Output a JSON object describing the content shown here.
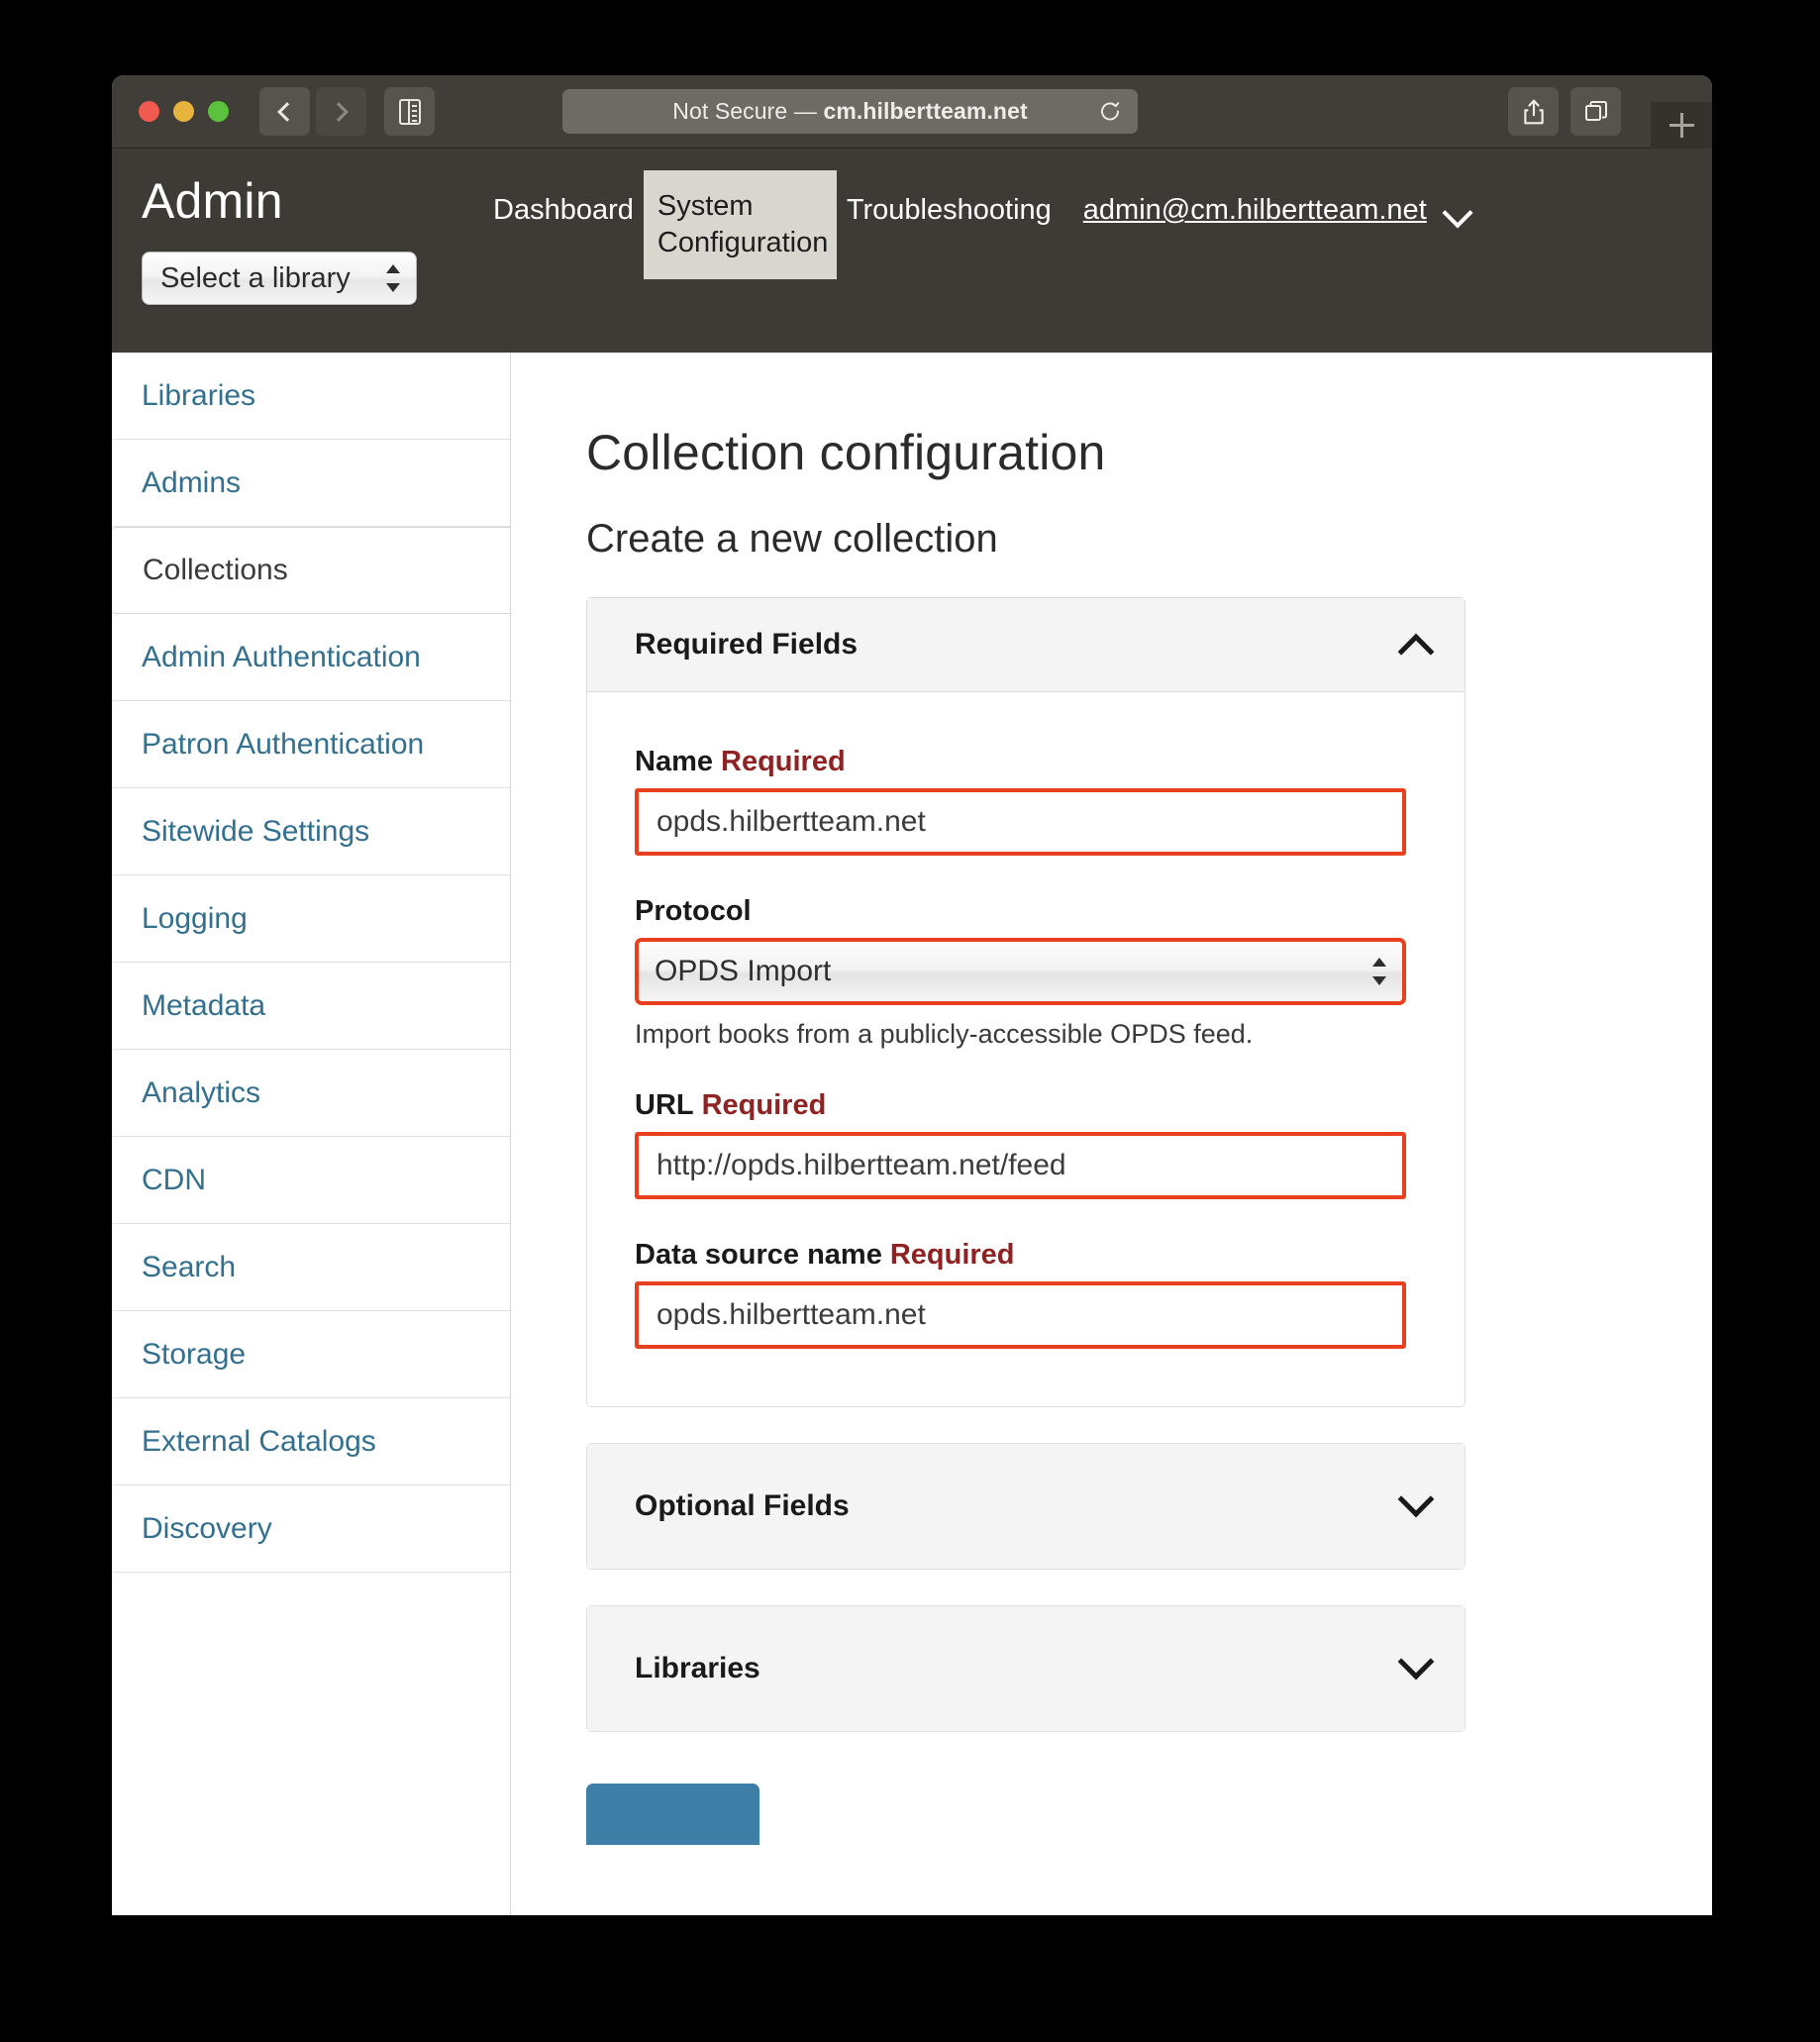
{
  "browser": {
    "url_prefix": "Not Secure",
    "url_separator": "—",
    "url_host": "cm.hilbertteam.net",
    "back_icon": "chevron-left-icon",
    "forward_icon": "chevron-right-icon",
    "sidebar_icon": "sidebar-toggle-icon",
    "reload_icon": "reload-icon",
    "share_icon": "share-icon",
    "tabs_icon": "tab-overview-icon",
    "new_tab_icon": "plus-icon"
  },
  "app_nav": {
    "title": "Admin",
    "library_select_value": "Select a library",
    "links": [
      {
        "label": "Dashboard",
        "active": false
      },
      {
        "label": "System Configuration",
        "active": true
      },
      {
        "label": "Troubleshooting",
        "active": false
      }
    ],
    "user_email": "admin@cm.hilbertteam.net",
    "user_caret_icon": "chevron-down-icon"
  },
  "sidebar": {
    "items": [
      {
        "label": "Libraries",
        "active": false
      },
      {
        "label": "Admins",
        "active": false
      },
      {
        "label": "Collections",
        "active": true
      },
      {
        "label": "Admin Authentication",
        "active": false
      },
      {
        "label": "Patron Authentication",
        "active": false
      },
      {
        "label": "Sitewide Settings",
        "active": false
      },
      {
        "label": "Logging",
        "active": false
      },
      {
        "label": "Metadata",
        "active": false
      },
      {
        "label": "Analytics",
        "active": false
      },
      {
        "label": "CDN",
        "active": false
      },
      {
        "label": "Search",
        "active": false
      },
      {
        "label": "Storage",
        "active": false
      },
      {
        "label": "External Catalogs",
        "active": false
      },
      {
        "label": "Discovery",
        "active": false
      }
    ]
  },
  "main": {
    "page_title": "Collection configuration",
    "section_title": "Create a new collection",
    "panels": {
      "required": {
        "title": "Required Fields",
        "expanded": true,
        "caret_icon": "chevron-up-icon"
      },
      "optional": {
        "title": "Optional Fields",
        "expanded": false,
        "caret_icon": "chevron-down-icon"
      },
      "libraries": {
        "title": "Libraries",
        "expanded": false,
        "caret_icon": "chevron-down-icon"
      }
    },
    "fields": {
      "name": {
        "label": "Name",
        "required_tag": "Required",
        "value": "opds.hilbertteam.net"
      },
      "protocol": {
        "label": "Protocol",
        "required_tag": "",
        "value": "OPDS Import",
        "help": "Import books from a publicly-accessible OPDS feed.",
        "stepper_icon": "stepper-updown-icon"
      },
      "url": {
        "label": "URL",
        "required_tag": "Required",
        "value": "http://opds.hilbertteam.net/feed"
      },
      "data_source_name": {
        "label": "Data source name",
        "required_tag": "Required",
        "value": "opds.hilbertteam.net"
      }
    },
    "submit_button_label": ""
  },
  "colors": {
    "nav_bg": "#3e3a35",
    "link_blue": "#33708f",
    "required_red": "#8f2222",
    "input_highlight": "#e8401f",
    "submit_blue": "#3d7fa6",
    "panel_head_bg": "#f4f4f4"
  }
}
